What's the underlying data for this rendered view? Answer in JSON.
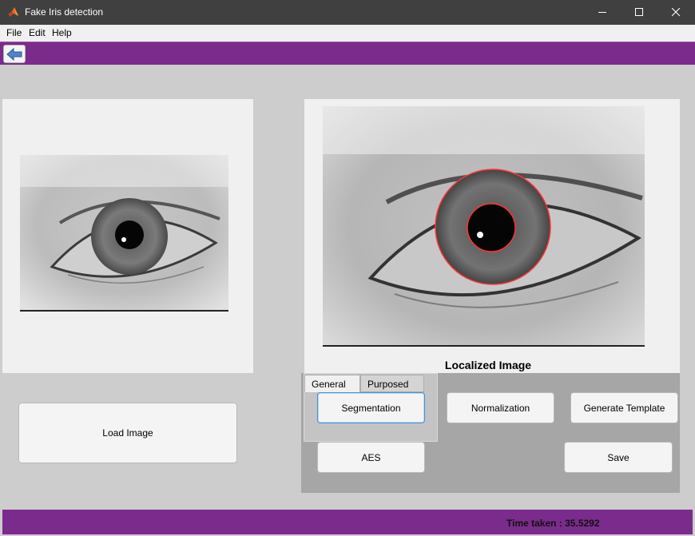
{
  "window": {
    "title": "Fake Iris detection",
    "app_icon": "matlab-icon",
    "controls": [
      "minimize-icon",
      "maximize-icon",
      "close-icon"
    ]
  },
  "menu": {
    "items": [
      {
        "label": "File"
      },
      {
        "label": "Edit"
      },
      {
        "label": "Help"
      }
    ]
  },
  "toolbar": {
    "back_icon": "arrow-left-icon"
  },
  "images": {
    "original_icon": "eye-image",
    "localized_icon": "eye-localized-image",
    "localized_label": "Localized Image",
    "circle_color": "#ff3333"
  },
  "tabs": [
    {
      "label": "General",
      "selected": true
    },
    {
      "label": "Purposed",
      "selected": false
    }
  ],
  "buttons": {
    "load_image": "Load Image",
    "segmentation": "Segmentation",
    "normalization": "Normalization",
    "generate_template": "Generate Template",
    "aes": "AES",
    "save": "Save"
  },
  "status": {
    "time_taken": "Time taken : 35.5292"
  },
  "colors": {
    "accent": "#7b2b8c",
    "titlebar": "#404040",
    "background": "#cdcdcd"
  }
}
